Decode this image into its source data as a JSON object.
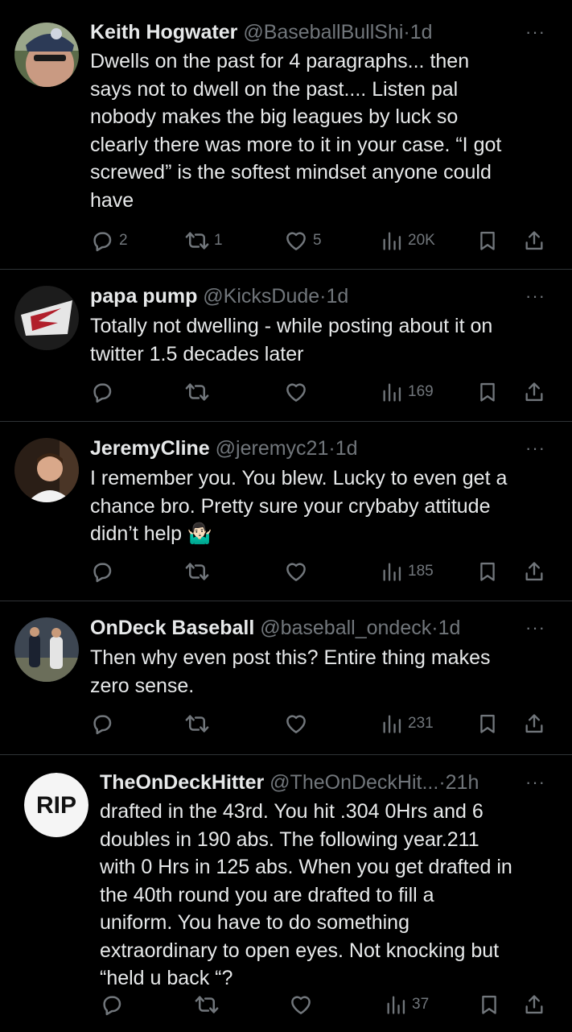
{
  "colors": {
    "background": "#000000",
    "text": "#e7e9ea",
    "secondary": "#71767b",
    "divider": "#2f3336"
  },
  "tweets": [
    {
      "name": "Keith Hogwater",
      "handle": "@BaseballBullShi",
      "dot": "·",
      "time": "1d",
      "text": "Dwells on the past for 4 paragraphs... then\nsays not to dwell on the past.... Listen pal\nnobody makes the big leagues by luck so\nclearly there was more to it in your case. “I got\nscrewed” is the softest mindset anyone could\nhave",
      "replies": "2",
      "reposts": "1",
      "likes": "5",
      "views": "20K"
    },
    {
      "name": "papa pump",
      "handle": "@KicksDude",
      "dot": "·",
      "time": "1d",
      "text": "Totally not dwelling - while posting about it on\ntwitter 1.5 decades later",
      "replies": "",
      "reposts": "",
      "likes": "",
      "views": "169"
    },
    {
      "name": "JeremyCline",
      "handle": "@jeremyc21",
      "dot": "·",
      "time": "1d",
      "text": "I remember you. You blew. Lucky to even get a\nchance bro. Pretty sure your crybaby attitude\ndidn’t help 🤷🏻‍♂️",
      "replies": "",
      "reposts": "",
      "likes": "",
      "views": "185"
    },
    {
      "name": "OnDeck Baseball",
      "handle": "@baseball_ondeck",
      "dot": "·",
      "time": "1d",
      "text": "Then why even post this? Entire thing makes\nzero sense.",
      "replies": "",
      "reposts": "",
      "likes": "",
      "views": "231"
    },
    {
      "name": "TheOnDeckHitter",
      "handle": "@TheOnDeckHit...",
      "dot": "·",
      "time": "21h",
      "avatar_text": "RIP",
      "text": "drafted in the 43rd. You hit .304 0Hrs and 6\ndoubles in 190 abs.  The following year.211\nwith 0 Hrs in 125 abs. When you get drafted in\nthe 40th round you are drafted to fill a\nuniform. You have to do something\nextraordinary to open eyes. Not knocking but\n“held u back “?",
      "replies": "",
      "reposts": "",
      "likes": "",
      "views": "37"
    }
  ],
  "icons": {
    "reply": "reply-icon",
    "repost": "repost-icon",
    "like": "like-icon",
    "views": "views-icon",
    "bookmark": "bookmark-icon",
    "share": "share-icon",
    "more": "more-icon"
  },
  "more_label": "···"
}
